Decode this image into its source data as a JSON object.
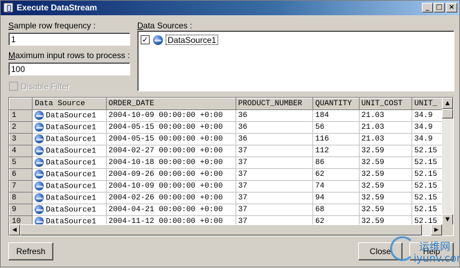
{
  "window": {
    "title": "Execute DataStream",
    "controls": [
      "_",
      "□",
      "×"
    ]
  },
  "sample": {
    "label_prefix": "S",
    "label_rest": "ample row frequency :",
    "value": "1"
  },
  "max_rows": {
    "label_prefix": "M",
    "label_rest": "aximum input rows to process :",
    "value": "100"
  },
  "disable_filter": {
    "label": "Disable Filter",
    "checked": false,
    "enabled": false
  },
  "data_sources": {
    "label_prefix": "D",
    "label_rest": "ata Sources :",
    "items": [
      {
        "name": "DataSource1",
        "checked": true
      }
    ]
  },
  "table": {
    "columns": [
      "Data Source",
      "ORDER_DATE",
      "PRODUCT_NUMBER",
      "QUANTITY",
      "UNIT_COST",
      "UNIT_"
    ],
    "rows": [
      {
        "n": "1",
        "source": "DataSource1",
        "order_date": "2004-10-09 00:00:00 +0:00",
        "product_number": "36",
        "quantity": "184",
        "unit_cost": "21.03",
        "unit_price": "34.9"
      },
      {
        "n": "2",
        "source": "DataSource1",
        "order_date": "2004-05-15 00:00:00 +0:00",
        "product_number": "36",
        "quantity": "56",
        "unit_cost": "21.03",
        "unit_price": "34.9"
      },
      {
        "n": "3",
        "source": "DataSource1",
        "order_date": "2004-05-15 00:00:00 +0:00",
        "product_number": "36",
        "quantity": "116",
        "unit_cost": "21.03",
        "unit_price": "34.9"
      },
      {
        "n": "4",
        "source": "DataSource1",
        "order_date": "2004-02-27 00:00:00 +0:00",
        "product_number": "37",
        "quantity": "112",
        "unit_cost": "32.59",
        "unit_price": "52.15"
      },
      {
        "n": "5",
        "source": "DataSource1",
        "order_date": "2004-10-18 00:00:00 +0:00",
        "product_number": "37",
        "quantity": "86",
        "unit_cost": "32.59",
        "unit_price": "52.15"
      },
      {
        "n": "6",
        "source": "DataSource1",
        "order_date": "2004-09-26 00:00:00 +0:00",
        "product_number": "37",
        "quantity": "62",
        "unit_cost": "32.59",
        "unit_price": "52.15"
      },
      {
        "n": "7",
        "source": "DataSource1",
        "order_date": "2004-10-09 00:00:00 +0:00",
        "product_number": "37",
        "quantity": "74",
        "unit_cost": "32.59",
        "unit_price": "52.15"
      },
      {
        "n": "8",
        "source": "DataSource1",
        "order_date": "2004-02-26 00:00:00 +0:00",
        "product_number": "37",
        "quantity": "94",
        "unit_cost": "32.59",
        "unit_price": "52.15"
      },
      {
        "n": "9",
        "source": "DataSource1",
        "order_date": "2004-04-21 00:00:00 +0:00",
        "product_number": "37",
        "quantity": "68",
        "unit_cost": "32.59",
        "unit_price": "52.15"
      },
      {
        "n": "10",
        "source": "DataSource1",
        "order_date": "2004-11-12 00:00:00 +0:00",
        "product_number": "37",
        "quantity": "62",
        "unit_cost": "32.59",
        "unit_price": "52.15"
      }
    ]
  },
  "buttons": {
    "refresh": "Refresh",
    "close": "Close",
    "help": "Help"
  },
  "watermark": {
    "cn": "运维网",
    "en": "iyunv.com"
  },
  "colors": {
    "title_gradient_start": "#0a246a",
    "title_gradient_end": "#a6caf0",
    "face": "#d4d0c8"
  },
  "icons": {
    "app": "datastream-icon",
    "source": "database-icon"
  }
}
